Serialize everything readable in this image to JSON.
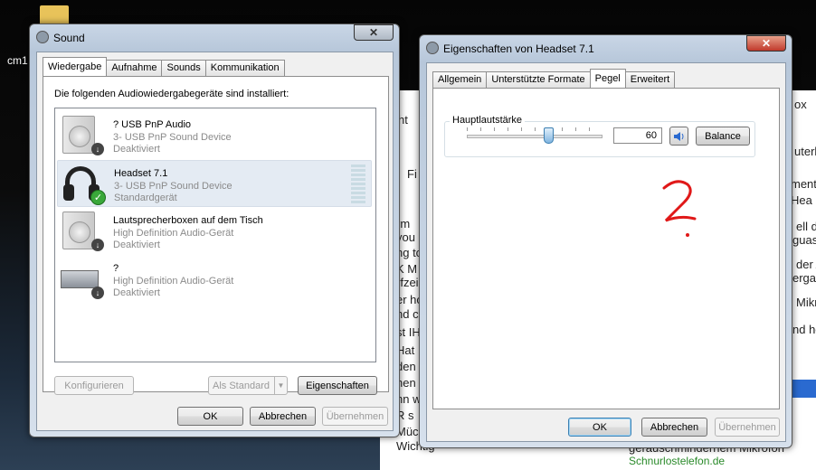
{
  "desktop": {
    "label": "cm1"
  },
  "background_page": {
    "lines": [
      "ht",
      "Fi",
      "rm",
      "you",
      "ng to",
      "K M",
      "rfzei",
      "er ho",
      "nd cu",
      "st IH",
      "Hat",
      "den",
      "nen s",
      "nn wi",
      "R s",
      "Mück",
      "Wichtig"
    ],
    "right_lines": [
      "ox",
      "uterb",
      "ment.p",
      "Hea",
      "ell d",
      "guas",
      "der A",
      "erga",
      "Mikr",
      "nd he"
    ],
    "footer": "Schnurlostelefon.de",
    "cut_text": "geräuschmindernem Mikrofon"
  },
  "sound_window": {
    "title": "Sound",
    "close_label": "✕",
    "tabs": [
      "Wiedergabe",
      "Aufnahme",
      "Sounds",
      "Kommunikation"
    ],
    "active_tab": "Wiedergabe",
    "instruction": "Die folgenden Audiowiedergabegeräte sind installiert:",
    "devices": [
      {
        "name": "? USB PnP Audio",
        "line1": "3- USB PnP Sound Device",
        "line2": "Deaktiviert",
        "icon": "speaker-icon",
        "status": "disabled"
      },
      {
        "name": "Headset 7.1",
        "line1": "3- USB PnP Sound Device",
        "line2": "Standardgerät",
        "icon": "headset-icon",
        "status": "default"
      },
      {
        "name": "Lautsprecherboxen auf dem Tisch",
        "line1": "High Definition Audio-Gerät",
        "line2": "Deaktiviert",
        "icon": "speaker-icon",
        "status": "disabled"
      },
      {
        "name": "?",
        "line1": "High Definition Audio-Gerät",
        "line2": "Deaktiviert",
        "icon": "digital-output-icon",
        "status": "disabled"
      }
    ],
    "buttons": {
      "configure": "Konfigurieren",
      "set_default": "Als Standard",
      "properties": "Eigenschaften",
      "ok": "OK",
      "cancel": "Abbrechen",
      "apply": "Übernehmen"
    }
  },
  "props_window": {
    "title": "Eigenschaften von Headset 7.1",
    "close_label": "✕",
    "tabs": [
      "Allgemein",
      "Unterstützte Formate",
      "Pegel",
      "Erweitert"
    ],
    "active_tab": "Pegel",
    "master_volume": {
      "label": "Hauptlautstärke",
      "value": "60",
      "level": 0.6
    },
    "balance_label": "Balance",
    "annotation": "?",
    "buttons": {
      "ok": "OK",
      "cancel": "Abbrechen",
      "apply": "Übernehmen"
    }
  }
}
